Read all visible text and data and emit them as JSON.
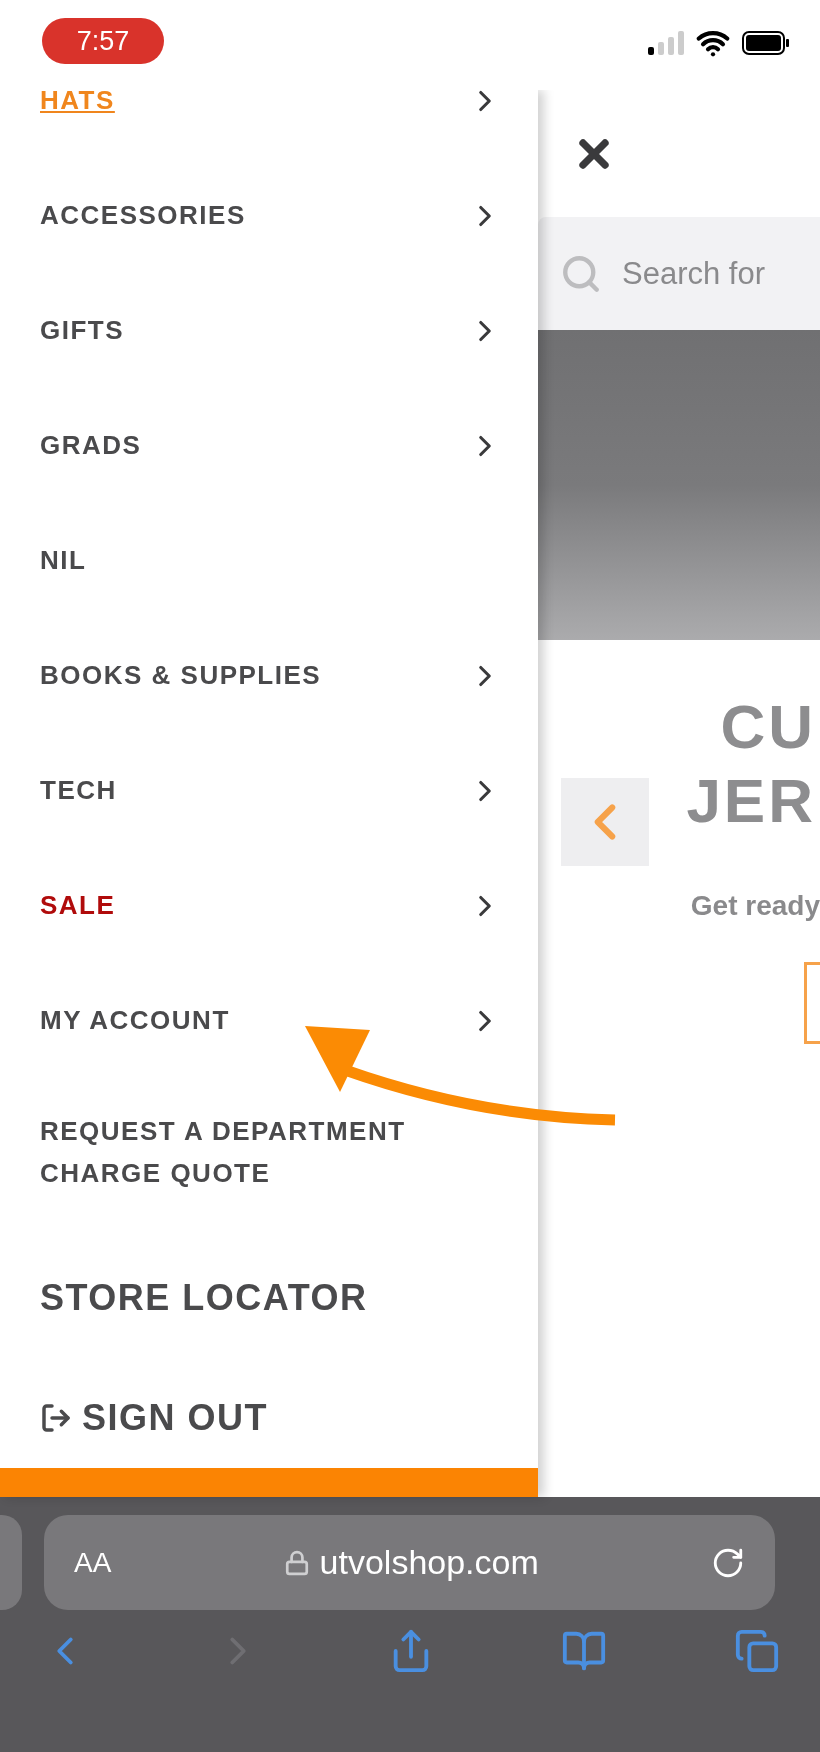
{
  "status_bar": {
    "time": "7:57"
  },
  "menu": {
    "items": [
      {
        "label": "HATS",
        "kind": "category",
        "selected": true,
        "expandable": true
      },
      {
        "label": "ACCESSORIES",
        "kind": "category",
        "selected": false,
        "expandable": true
      },
      {
        "label": "GIFTS",
        "kind": "category",
        "selected": false,
        "expandable": true
      },
      {
        "label": "GRADS",
        "kind": "category",
        "selected": false,
        "expandable": true
      },
      {
        "label": "NIL",
        "kind": "category",
        "selected": false,
        "expandable": false
      },
      {
        "label": "BOOKS & SUPPLIES",
        "kind": "category",
        "selected": false,
        "expandable": true
      },
      {
        "label": "TECH",
        "kind": "category",
        "selected": false,
        "expandable": true
      },
      {
        "label": "SALE",
        "kind": "sale",
        "selected": false,
        "expandable": true
      },
      {
        "label": "MY ACCOUNT",
        "kind": "category",
        "selected": false,
        "expandable": true
      },
      {
        "label": "REQUEST A DEPARTMENT CHARGE QUOTE",
        "kind": "category",
        "selected": false,
        "expandable": false
      },
      {
        "label": "STORE LOCATOR",
        "kind": "large",
        "selected": false,
        "expandable": false
      },
      {
        "label": "SIGN OUT",
        "kind": "signout",
        "selected": false,
        "expandable": false
      }
    ]
  },
  "page": {
    "search": {
      "placeholder": "Search for"
    },
    "title_lines": [
      "CU",
      "JER"
    ],
    "subtitle": "Get ready"
  },
  "browser": {
    "text_size": "AA",
    "url": "utvolshop.com",
    "toolbar": [
      {
        "kind": "back",
        "disabled": false
      },
      {
        "kind": "forward",
        "disabled": true
      },
      {
        "kind": "share",
        "disabled": false
      },
      {
        "kind": "bookmarks",
        "disabled": false
      },
      {
        "kind": "tabs",
        "disabled": false
      }
    ]
  }
}
